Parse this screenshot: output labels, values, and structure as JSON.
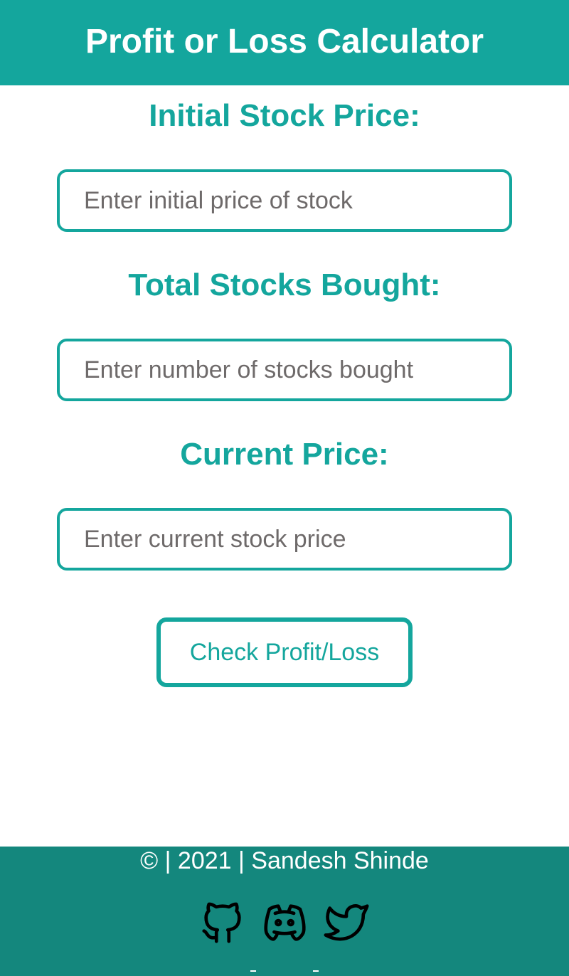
{
  "header": {
    "title": "Profit or Loss Calculator"
  },
  "form": {
    "initial_price": {
      "label": "Initial Stock Price:",
      "placeholder": "Enter initial price of stock"
    },
    "quantity": {
      "label": "Total Stocks Bought:",
      "placeholder": "Enter number of stocks bought"
    },
    "current_price": {
      "label": "Current Price:",
      "placeholder": "Enter current stock price"
    },
    "submit_label": "Check Profit/Loss"
  },
  "footer": {
    "copyright": "© | 2021 | Sandesh Shinde",
    "social_icons": [
      "github-icon",
      "discord-icon",
      "twitter-icon"
    ]
  },
  "colors": {
    "accent": "#14a69d",
    "footer_bg": "#14877d",
    "placeholder": "#6e6a6a"
  }
}
